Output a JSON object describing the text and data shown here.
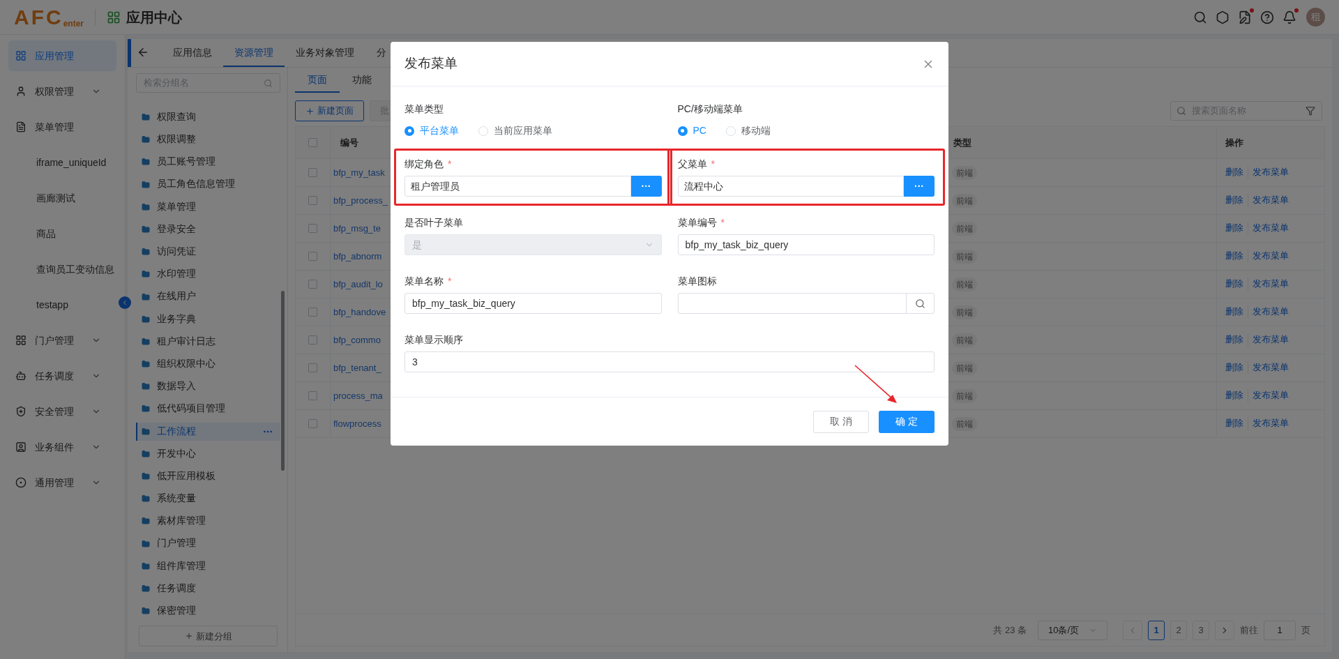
{
  "header": {
    "logo_main": "AFC",
    "logo_sub": "enter",
    "app_title": "应用中心",
    "avatar": "租",
    "icons": [
      {
        "badge": false
      },
      {
        "badge": false
      },
      {
        "badge": true
      },
      {
        "badge": false
      },
      {
        "badge": true
      }
    ]
  },
  "sidebar": {
    "items": [
      {
        "label": "应用管理",
        "kind": "item",
        "selected": true
      },
      {
        "label": "权限管理",
        "kind": "group",
        "selected": false
      },
      {
        "label": "菜单管理",
        "kind": "item",
        "selected": false
      },
      {
        "label": "iframe_uniqueId",
        "kind": "sub",
        "selected": false
      },
      {
        "label": "画廊测试",
        "kind": "sub",
        "selected": false
      },
      {
        "label": "商品",
        "kind": "sub",
        "selected": false
      },
      {
        "label": "查询员工变动信息",
        "kind": "sub",
        "selected": false
      },
      {
        "label": "testapp",
        "kind": "sub",
        "selected": false
      },
      {
        "label": "门户管理",
        "kind": "group",
        "selected": false
      },
      {
        "label": "任务调度",
        "kind": "group",
        "selected": false
      },
      {
        "label": "安全管理",
        "kind": "group",
        "selected": false
      },
      {
        "label": "业务组件",
        "kind": "group",
        "selected": false
      },
      {
        "label": "通用管理",
        "kind": "group",
        "selected": false
      }
    ]
  },
  "tabs": [
    {
      "label": "应用信息",
      "selected": false
    },
    {
      "label": "资源管理",
      "selected": true
    },
    {
      "label": "业务对象管理",
      "selected": false
    },
    {
      "label": "分",
      "selected": false
    }
  ],
  "groups": {
    "search_placeholder": "检索分组名",
    "items": [
      {
        "label": "权限查询",
        "selected": false
      },
      {
        "label": "权限调整",
        "selected": false
      },
      {
        "label": "员工账号管理",
        "selected": false
      },
      {
        "label": "员工角色信息管理",
        "selected": false
      },
      {
        "label": "菜单管理",
        "selected": false
      },
      {
        "label": "登录安全",
        "selected": false
      },
      {
        "label": "访问凭证",
        "selected": false
      },
      {
        "label": "水印管理",
        "selected": false
      },
      {
        "label": "在线用户",
        "selected": false
      },
      {
        "label": "业务字典",
        "selected": false
      },
      {
        "label": "租户审计日志",
        "selected": false
      },
      {
        "label": "组织权限中心",
        "selected": false
      },
      {
        "label": "数据导入",
        "selected": false
      },
      {
        "label": "低代码项目管理",
        "selected": false
      },
      {
        "label": "工作流程",
        "selected": true
      },
      {
        "label": "开发中心",
        "selected": false
      },
      {
        "label": "低开应用模板",
        "selected": false
      },
      {
        "label": "系统变量",
        "selected": false
      },
      {
        "label": "素材库管理",
        "selected": false
      },
      {
        "label": "门户管理",
        "selected": false
      },
      {
        "label": "组件库管理",
        "selected": false
      },
      {
        "label": "任务调度",
        "selected": false
      },
      {
        "label": "保密管理",
        "selected": false
      }
    ],
    "add_button": "新建分组"
  },
  "subtabs": [
    {
      "label": "页面",
      "selected": true
    },
    {
      "label": "功能",
      "selected": false
    }
  ],
  "toolbar": {
    "new_button": "新建页面",
    "batch_button": "批",
    "search_placeholder": "搜索页面名称"
  },
  "table": {
    "columns": [
      "编号",
      "类型",
      "操作"
    ],
    "header_checked": false,
    "rows": [
      {
        "code": "bfp_my_task",
        "checked": false,
        "type": "前端",
        "actions": [
          "删除",
          "发布菜单"
        ]
      },
      {
        "code": "bfp_process_",
        "checked": false,
        "type": "前端",
        "actions": [
          "删除",
          "发布菜单"
        ]
      },
      {
        "code": "bfp_msg_te",
        "checked": false,
        "type": "前端",
        "actions": [
          "删除",
          "发布菜单"
        ]
      },
      {
        "code": "bfp_abnorm",
        "checked": false,
        "type": "前端",
        "actions": [
          "删除",
          "发布菜单"
        ]
      },
      {
        "code": "bfp_audit_lo",
        "checked": false,
        "type": "前端",
        "actions": [
          "删除",
          "发布菜单"
        ]
      },
      {
        "code": "bfp_handove",
        "checked": false,
        "type": "前端",
        "actions": [
          "删除",
          "发布菜单"
        ]
      },
      {
        "code": "bfp_commo",
        "checked": false,
        "type": "前端",
        "actions": [
          "删除",
          "发布菜单"
        ]
      },
      {
        "code": "bfp_tenant_",
        "checked": false,
        "type": "前端",
        "actions": [
          "删除",
          "发布菜单"
        ]
      },
      {
        "code": "process_ma",
        "checked": false,
        "type": "前端",
        "actions": [
          "删除",
          "发布菜单"
        ]
      },
      {
        "code": "flowprocess",
        "checked": false,
        "type": "前端",
        "actions": [
          "删除",
          "发布菜单"
        ]
      }
    ]
  },
  "pagination": {
    "total": "共 23 条",
    "page_size": "10条/页",
    "pages": [
      {
        "label": "1",
        "selected": true
      },
      {
        "label": "2",
        "selected": false
      },
      {
        "label": "3",
        "selected": false
      }
    ],
    "goto_label": "前往",
    "goto_value": "1",
    "goto_suffix": "页"
  },
  "dialog": {
    "title": "发布菜单",
    "radio_groups": [
      {
        "label": "菜单类型",
        "options": [
          {
            "label": "平台菜单",
            "selected": true
          },
          {
            "label": "当前应用菜单",
            "selected": false
          }
        ]
      },
      {
        "label": "PC/移动端菜单",
        "options": [
          {
            "label": "PC",
            "selected": true
          },
          {
            "label": "移动端",
            "selected": false
          }
        ]
      }
    ],
    "fields": [
      {
        "label": "绑定角色",
        "required": true,
        "kind": "picker",
        "value": "租户管理员",
        "highlighted": true,
        "disabled": false,
        "button": "···"
      },
      {
        "label": "父菜单",
        "required": true,
        "kind": "picker",
        "value": "流程中心",
        "highlighted": true,
        "disabled": false,
        "button": "···"
      },
      {
        "label": "是否叶子菜单",
        "required": false,
        "kind": "select",
        "value": "是",
        "highlighted": false,
        "disabled": true
      },
      {
        "label": "菜单编号",
        "required": true,
        "kind": "text",
        "value": "bfp_my_task_biz_query",
        "highlighted": false,
        "disabled": false
      },
      {
        "label": "菜单名称",
        "required": true,
        "kind": "text",
        "value": "bfp_my_task_biz_query",
        "highlighted": false,
        "disabled": false
      },
      {
        "label": "菜单图标",
        "required": false,
        "kind": "search",
        "highlighted": false,
        "disabled": false
      },
      {
        "label": "菜单显示顺序",
        "required": false,
        "kind": "text",
        "value": "3",
        "highlighted": false,
        "disabled": false,
        "full": true
      }
    ],
    "required_mark": "*",
    "cancel": "取 消",
    "ok": "确 定"
  }
}
